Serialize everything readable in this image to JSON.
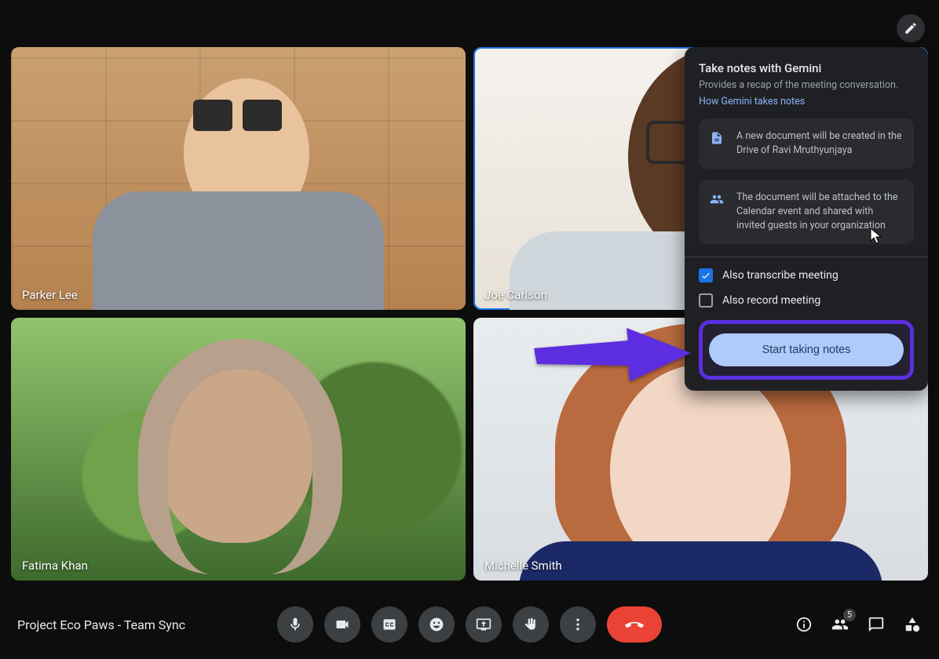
{
  "meeting": {
    "title": "Project Eco Paws - Team Sync"
  },
  "participants": [
    {
      "name": "Parker Lee"
    },
    {
      "name": "Joe Carlson"
    },
    {
      "name": "Fatima Khan"
    },
    {
      "name": "Michelle Smith"
    }
  ],
  "people_badge": "5",
  "panel": {
    "title": "Take notes with Gemini",
    "subtitle": "Provides a recap of the meeting conversation.",
    "link": "How Gemini takes notes",
    "info1": "A new document will be created in the Drive of Ravi Mruthyunjaya",
    "info2": "The document will be attached to the Calendar event and shared with invited guests in your organization",
    "check_transcribe": "Also transcribe meeting",
    "check_record": "Also record meeting",
    "start_label": "Start taking notes"
  }
}
